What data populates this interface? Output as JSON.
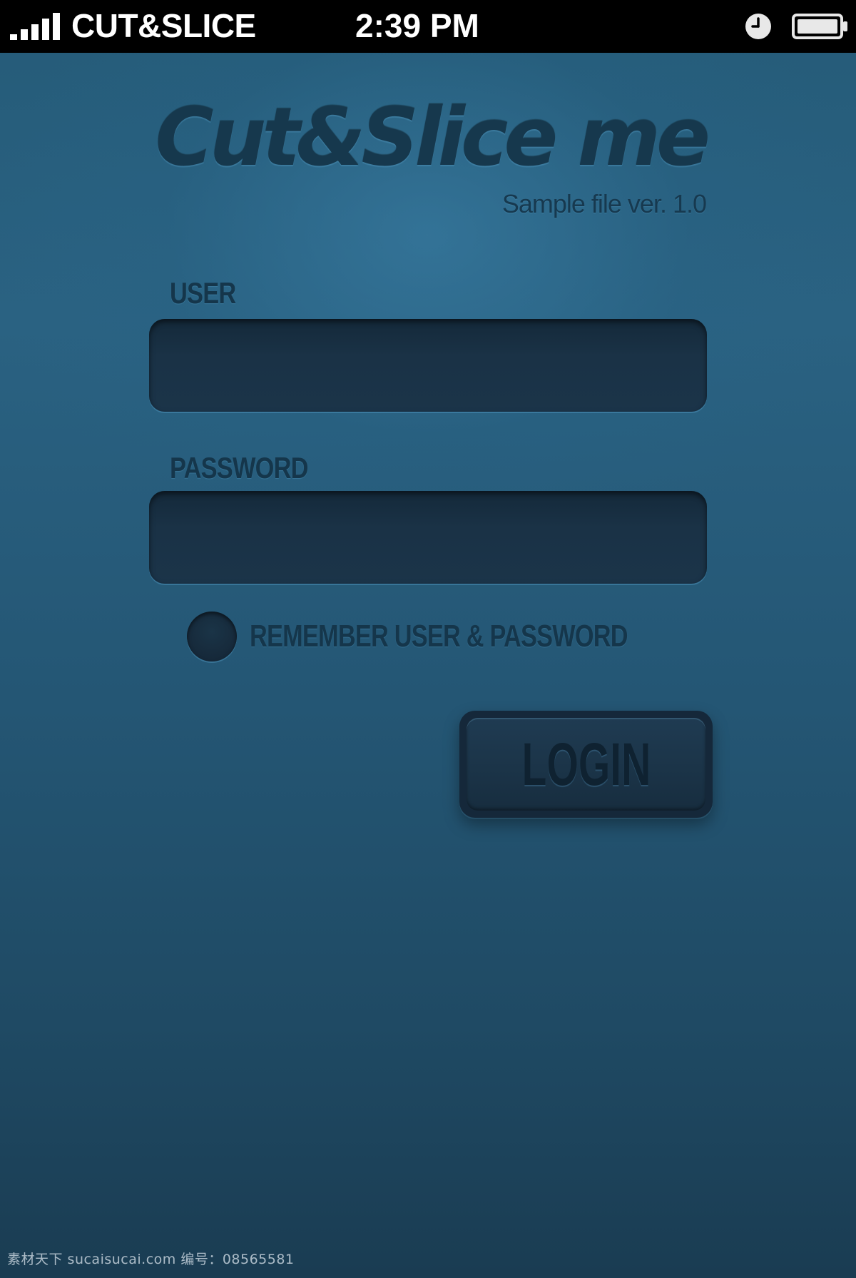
{
  "status_bar": {
    "carrier": "CUT&SLICE",
    "time": "2:39 PM",
    "signal_icon": "signal-bars-icon",
    "alarm_icon": "alarm-clock-icon",
    "battery_icon": "battery-icon"
  },
  "logo": {
    "title": "Cut&Slice me",
    "subtitle": "Sample file ver. 1.0"
  },
  "form": {
    "user_label": "USER",
    "user_value": "",
    "password_label": "PASSWORD",
    "password_value": "",
    "remember_label": "REMEMBER USER & PASSWORD",
    "remember_checked": false,
    "login_label": "LOGIN"
  },
  "watermark": {
    "text": "素材天下 sucaisucai.com  编号：08565581"
  },
  "colors": {
    "background": "#265d7b",
    "status_bar": "#000000",
    "field_fill": "#1a3246",
    "text_dark": "#15364b"
  }
}
